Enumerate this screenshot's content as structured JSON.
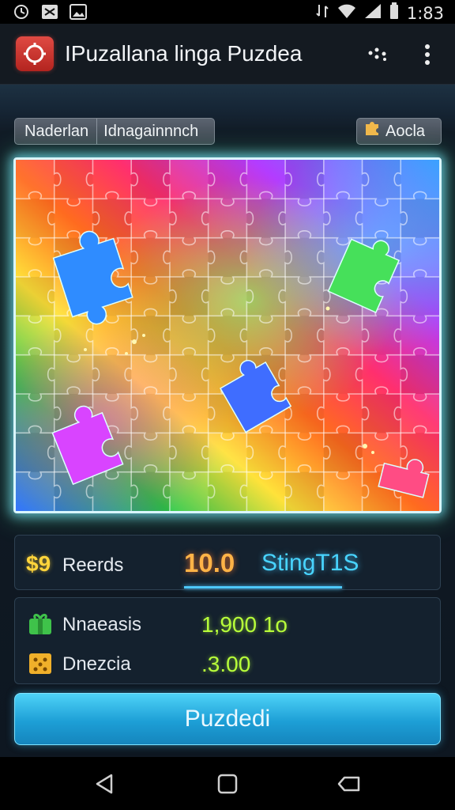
{
  "status_bar": {
    "time": "1:83",
    "left_icons": [
      "clock-icon",
      "shuffle-icon",
      "image-icon"
    ],
    "right_icons": [
      "data-sync-icon",
      "wifi-icon",
      "signal-icon",
      "battery-icon"
    ]
  },
  "app_bar": {
    "title": "IPuzallana linga Puzdea",
    "icon": "puzzle-app-icon",
    "actions": [
      "sparkle-icon",
      "more-vert-icon"
    ]
  },
  "controls": {
    "chip_left_a": "Naderlan",
    "chip_left_b": "Idnagainnnch",
    "chip_right": "Aocla",
    "chip_right_icon": "puzzle-piece-icon"
  },
  "board": {
    "columns": 11,
    "rows": 9
  },
  "score": {
    "badge": "$9",
    "label": "Reerds",
    "value": "10.0",
    "mode": "StingT1S",
    "progress": 1.0,
    "accent": "#4ec9ff"
  },
  "stats": [
    {
      "icon": "green-gift-icon",
      "label": "Nnaeasis",
      "value": "1,900 1o"
    },
    {
      "icon": "yellow-tile-icon",
      "label": "Dnezcia",
      "value": ".3.00"
    }
  ],
  "primary_button": {
    "label": "Puzdedi"
  },
  "nav": [
    "back-icon",
    "home-icon",
    "recents-icon"
  ],
  "colors": {
    "score_value": "#ffb347",
    "score_mode": "#48d4ff",
    "stat_value": "#b8ff3a",
    "button": "#1d9fd6"
  }
}
